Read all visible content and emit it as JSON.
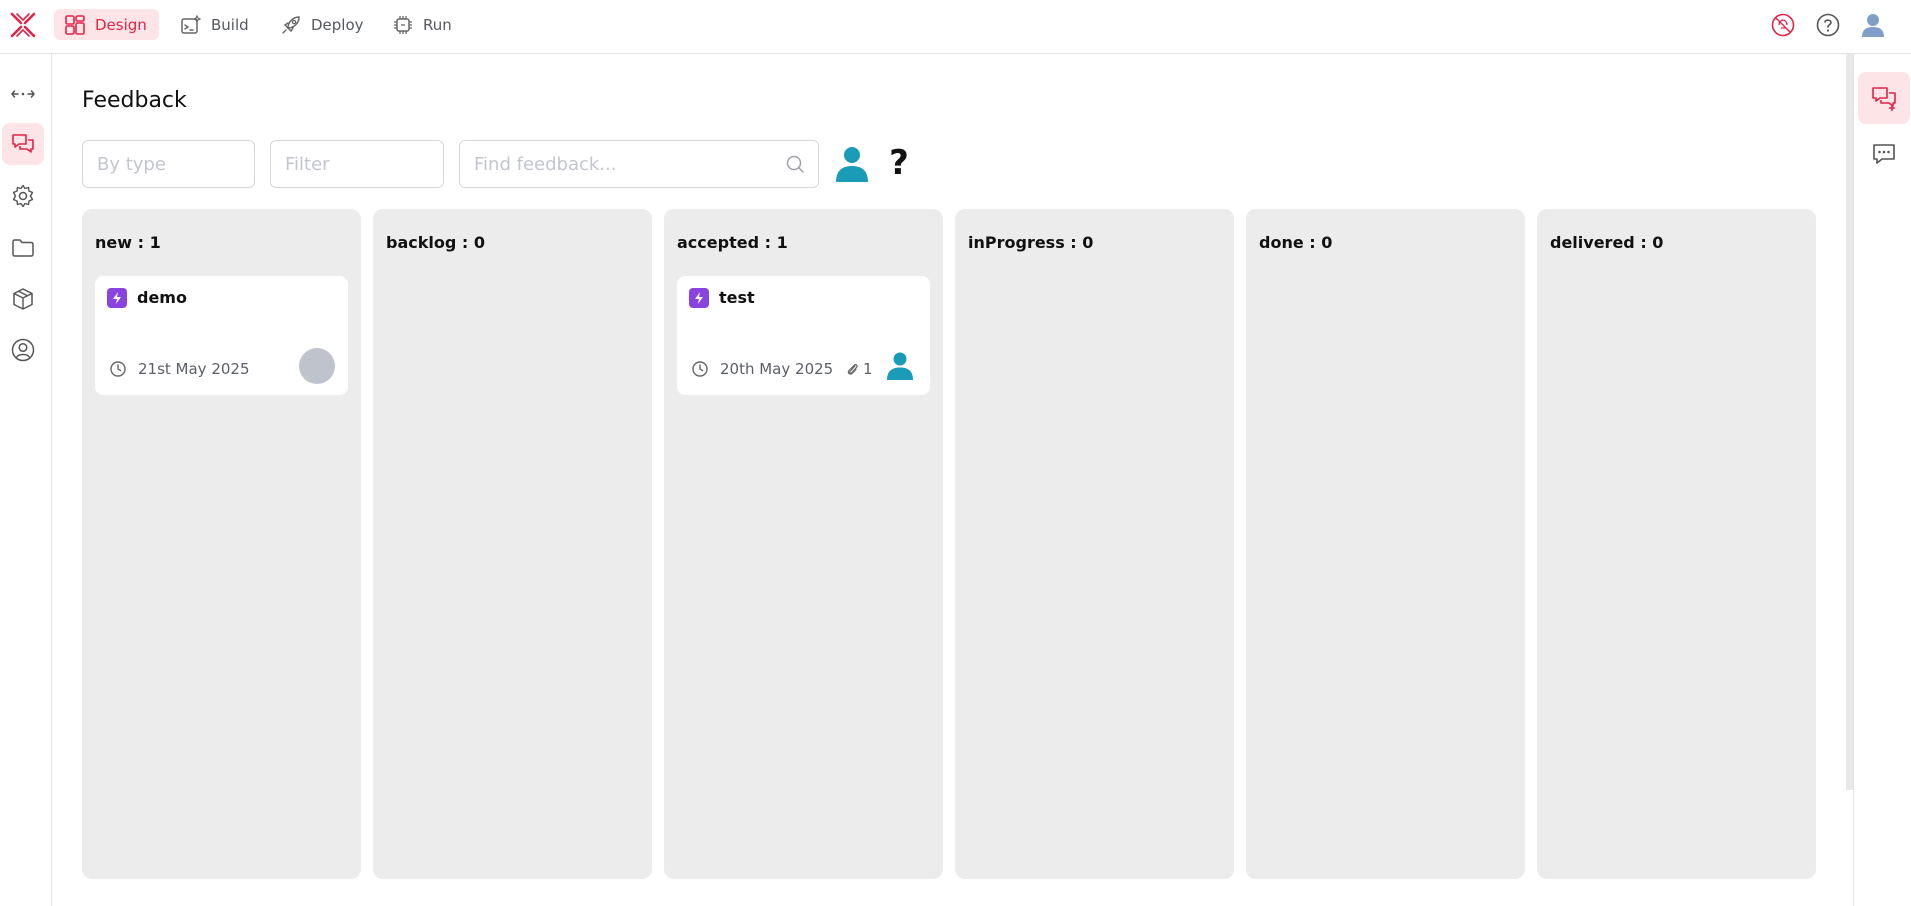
{
  "nav": {
    "items": [
      {
        "label": "Design",
        "icon": "design-grid-icon",
        "active": true
      },
      {
        "label": "Build",
        "icon": "build-icon",
        "active": false
      },
      {
        "label": "Deploy",
        "icon": "rocket-icon",
        "active": false
      },
      {
        "label": "Run",
        "icon": "run-chip-icon",
        "active": false
      }
    ],
    "brand_color": "#e0244a"
  },
  "page": {
    "title": "Feedback"
  },
  "filters": {
    "type_placeholder": "By type",
    "filter_placeholder": "Filter",
    "search_placeholder": "Find feedback..."
  },
  "help": {
    "label": "?"
  },
  "columns": [
    {
      "label": "new : 1",
      "cards": [
        {
          "title": "demo",
          "date": "21st May 2025",
          "attachments": "",
          "assignee": "none"
        }
      ]
    },
    {
      "label": "backlog : 0",
      "cards": []
    },
    {
      "label": "accepted : 1",
      "cards": [
        {
          "title": "test",
          "date": "20th May 2025",
          "attachments": "1",
          "assignee": "user"
        }
      ]
    },
    {
      "label": "inProgress : 0",
      "cards": []
    },
    {
      "label": "done : 0",
      "cards": []
    },
    {
      "label": "delivered : 0",
      "cards": []
    }
  ],
  "colors": {
    "accent": "#e0244a",
    "accent_bg": "#fde4e7",
    "type_badge": "#8b43e0",
    "user_teal": "#1a9bb8",
    "column_bg": "#ececec"
  }
}
